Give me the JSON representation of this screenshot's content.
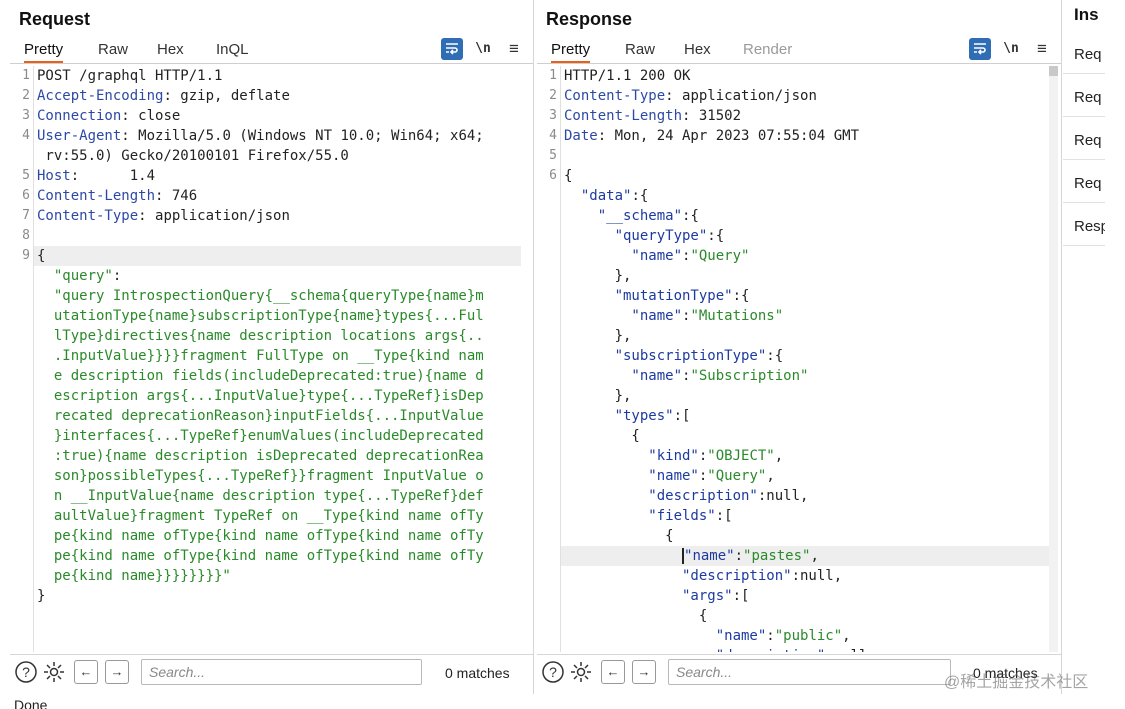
{
  "request": {
    "title": "Request",
    "tabs": [
      {
        "label": "Pretty",
        "active": true
      },
      {
        "label": "Raw"
      },
      {
        "label": "Hex"
      },
      {
        "label": "InQL"
      }
    ],
    "lines": [
      {
        "num": "1",
        "segs": [
          [
            "",
            "POST /graphql HTTP/1.1"
          ]
        ]
      },
      {
        "num": "2",
        "segs": [
          [
            "hk",
            "Accept-Encoding"
          ],
          [
            "",
            ": gzip, deflate"
          ]
        ]
      },
      {
        "num": "3",
        "segs": [
          [
            "hk",
            "Connection"
          ],
          [
            "",
            ": close"
          ]
        ]
      },
      {
        "num": "4",
        "segs": [
          [
            "hk",
            "User-Agent"
          ],
          [
            "",
            ": Mozilla/5.0 (Windows NT 10.0; Win64; x64;"
          ]
        ]
      },
      {
        "num": "",
        "segs": [
          [
            "",
            " rv:55.0) Gecko/20100101 Firefox/55.0"
          ]
        ]
      },
      {
        "num": "5",
        "segs": [
          [
            "hk",
            "Host"
          ],
          [
            "",
            ":      1.4    "
          ]
        ]
      },
      {
        "num": "6",
        "segs": [
          [
            "hk",
            "Content-Length"
          ],
          [
            "",
            ": 746"
          ]
        ]
      },
      {
        "num": "7",
        "segs": [
          [
            "hk",
            "Content-Type"
          ],
          [
            "",
            ": application/json"
          ]
        ]
      },
      {
        "num": "8",
        "segs": []
      },
      {
        "num": "9",
        "segs": [
          [
            "",
            "{"
          ]
        ],
        "hl": true
      },
      {
        "num": "",
        "segs": [
          [
            "js",
            "  \"query\""
          ],
          [
            "",
            ":"
          ]
        ]
      },
      {
        "num": "",
        "segs": [
          [
            "js",
            "  \"query IntrospectionQuery{__schema{queryType{name}m"
          ]
        ]
      },
      {
        "num": "",
        "segs": [
          [
            "js",
            "  utationType{name}subscriptionType{name}types{...Ful"
          ]
        ]
      },
      {
        "num": "",
        "segs": [
          [
            "js",
            "  lType}directives{name description locations args{.."
          ]
        ]
      },
      {
        "num": "",
        "segs": [
          [
            "js",
            "  .InputValue}}}}fragment FullType on __Type{kind nam"
          ]
        ]
      },
      {
        "num": "",
        "segs": [
          [
            "js",
            "  e description fields(includeDeprecated:true){name d"
          ]
        ]
      },
      {
        "num": "",
        "segs": [
          [
            "js",
            "  escription args{...InputValue}type{...TypeRef}isDep"
          ]
        ]
      },
      {
        "num": "",
        "segs": [
          [
            "js",
            "  recated deprecationReason}inputFields{...InputValue"
          ]
        ]
      },
      {
        "num": "",
        "segs": [
          [
            "js",
            "  }interfaces{...TypeRef}enumValues(includeDeprecated"
          ]
        ]
      },
      {
        "num": "",
        "segs": [
          [
            "js",
            "  :true){name description isDeprecated deprecationRea"
          ]
        ]
      },
      {
        "num": "",
        "segs": [
          [
            "js",
            "  son}possibleTypes{...TypeRef}}fragment InputValue o"
          ]
        ]
      },
      {
        "num": "",
        "segs": [
          [
            "js",
            "  n __InputValue{name description type{...TypeRef}def"
          ]
        ]
      },
      {
        "num": "",
        "segs": [
          [
            "js",
            "  aultValue}fragment TypeRef on __Type{kind name ofTy"
          ]
        ]
      },
      {
        "num": "",
        "segs": [
          [
            "js",
            "  pe{kind name ofType{kind name ofType{kind name ofTy"
          ]
        ]
      },
      {
        "num": "",
        "segs": [
          [
            "js",
            "  pe{kind name ofType{kind name ofType{kind name ofTy"
          ]
        ]
      },
      {
        "num": "",
        "segs": [
          [
            "js",
            "  pe{kind name}}}}}}}}\""
          ]
        ]
      },
      {
        "num": "",
        "segs": [
          [
            "",
            "}"
          ]
        ]
      }
    ],
    "footer": {
      "search_placeholder": "Search...",
      "matches": "0 matches"
    }
  },
  "response": {
    "title": "Response",
    "tabs": [
      {
        "label": "Pretty",
        "active": true
      },
      {
        "label": "Raw"
      },
      {
        "label": "Hex"
      },
      {
        "label": "Render",
        "disabled": true
      }
    ],
    "lines": [
      {
        "num": "1",
        "segs": [
          [
            "",
            "HTTP/1.1 200 OK"
          ]
        ]
      },
      {
        "num": "2",
        "segs": [
          [
            "hk",
            "Content-Type"
          ],
          [
            "",
            ": application/json"
          ]
        ]
      },
      {
        "num": "3",
        "segs": [
          [
            "hk",
            "Content-Length"
          ],
          [
            "",
            ": 31502"
          ]
        ]
      },
      {
        "num": "4",
        "segs": [
          [
            "hk",
            "Date"
          ],
          [
            "",
            ": Mon, 24 Apr 2023 07:55:04 GMT"
          ]
        ]
      },
      {
        "num": "5",
        "segs": []
      },
      {
        "num": "6",
        "segs": [
          [
            "",
            "{"
          ]
        ]
      },
      {
        "num": "",
        "segs": [
          [
            "jk",
            "  \"data\""
          ],
          [
            "",
            ":{"
          ]
        ]
      },
      {
        "num": "",
        "segs": [
          [
            "jk",
            "    \"__schema\""
          ],
          [
            "",
            ":{"
          ]
        ]
      },
      {
        "num": "",
        "segs": [
          [
            "jk",
            "      \"queryType\""
          ],
          [
            "",
            ":{"
          ]
        ]
      },
      {
        "num": "",
        "segs": [
          [
            "jk",
            "        \"name\""
          ],
          [
            "",
            ":"
          ],
          [
            "js",
            "\"Query\""
          ]
        ]
      },
      {
        "num": "",
        "segs": [
          [
            "",
            "      },"
          ]
        ]
      },
      {
        "num": "",
        "segs": [
          [
            "jk",
            "      \"mutationType\""
          ],
          [
            "",
            ":{"
          ]
        ]
      },
      {
        "num": "",
        "segs": [
          [
            "jk",
            "        \"name\""
          ],
          [
            "",
            ":"
          ],
          [
            "js",
            "\"Mutations\""
          ]
        ]
      },
      {
        "num": "",
        "segs": [
          [
            "",
            "      },"
          ]
        ]
      },
      {
        "num": "",
        "segs": [
          [
            "jk",
            "      \"subscriptionType\""
          ],
          [
            "",
            ":{"
          ]
        ]
      },
      {
        "num": "",
        "segs": [
          [
            "jk",
            "        \"name\""
          ],
          [
            "",
            ":"
          ],
          [
            "js",
            "\"Subscription\""
          ]
        ]
      },
      {
        "num": "",
        "segs": [
          [
            "",
            "      },"
          ]
        ]
      },
      {
        "num": "",
        "segs": [
          [
            "jk",
            "      \"types\""
          ],
          [
            "",
            ":["
          ]
        ]
      },
      {
        "num": "",
        "segs": [
          [
            "",
            "        {"
          ]
        ]
      },
      {
        "num": "",
        "segs": [
          [
            "jk",
            "          \"kind\""
          ],
          [
            "",
            ":"
          ],
          [
            "js",
            "\"OBJECT\""
          ],
          [
            "",
            ","
          ]
        ]
      },
      {
        "num": "",
        "segs": [
          [
            "jk",
            "          \"name\""
          ],
          [
            "",
            ":"
          ],
          [
            "js",
            "\"Query\""
          ],
          [
            "",
            ","
          ]
        ]
      },
      {
        "num": "",
        "segs": [
          [
            "jk",
            "          \"description\""
          ],
          [
            "",
            ":null,"
          ]
        ]
      },
      {
        "num": "",
        "segs": [
          [
            "jk",
            "          \"fields\""
          ],
          [
            "",
            ":["
          ]
        ]
      },
      {
        "num": "",
        "segs": [
          [
            "",
            "            {"
          ]
        ]
      },
      {
        "num": "",
        "segs": [
          [
            "",
            "              "
          ],
          [
            "jk cursor",
            "\"name\""
          ],
          [
            "",
            ":"
          ],
          [
            "js",
            "\"pastes\""
          ],
          [
            "",
            ","
          ]
        ],
        "hl": true
      },
      {
        "num": "",
        "segs": [
          [
            "jk",
            "              \"description\""
          ],
          [
            "",
            ":null,"
          ]
        ]
      },
      {
        "num": "",
        "segs": [
          [
            "jk",
            "              \"args\""
          ],
          [
            "",
            ":["
          ]
        ]
      },
      {
        "num": "",
        "segs": [
          [
            "",
            "                {"
          ]
        ]
      },
      {
        "num": "",
        "segs": [
          [
            "jk",
            "                  \"name\""
          ],
          [
            "",
            ":"
          ],
          [
            "js",
            "\"public\""
          ],
          [
            "",
            ","
          ]
        ]
      },
      {
        "num": "",
        "segs": [
          [
            "jk",
            "                  \"description\""
          ],
          [
            "",
            ":null"
          ]
        ]
      }
    ],
    "footer": {
      "search_placeholder": "Search...",
      "matches": "0 matches"
    }
  },
  "inspector": {
    "title": "Ins",
    "items": [
      "Req",
      "Req",
      "Req",
      "Req",
      "Resp"
    ]
  },
  "status": "Done",
  "watermark": "@稀土掘金技术社区"
}
